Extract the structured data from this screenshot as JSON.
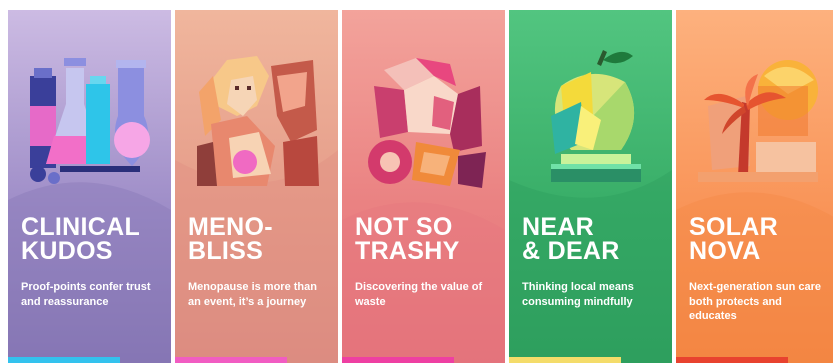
{
  "cards": [
    {
      "title": "CLINICAL\nKUDOS",
      "description": "Proof-points confer trust and reassurance",
      "accent_color": "#33c2ee",
      "background": [
        "#cbb9e2",
        "#9a88c4",
        "#8575b2"
      ],
      "icon": "lab-flasks-icon"
    },
    {
      "title": "MENO-\nBLISS",
      "description": "Menopause is more than an event, it’s a journey",
      "accent_color": "#f15cc2",
      "background": [
        "#f0b59c",
        "#e49a88",
        "#dc8d80"
      ],
      "icon": "woman-portrait-icon"
    },
    {
      "title": "NOT SO\nTRASHY",
      "description": "Discovering the value of waste",
      "accent_color": "#ee3fa2",
      "background": [
        "#f2a19a",
        "#ea7f80",
        "#e5727a"
      ],
      "icon": "crumpled-waste-icon"
    },
    {
      "title": "NEAR\n& DEAR",
      "description": "Thinking local means consuming mindfully",
      "accent_color": "#f4dc6a",
      "background": [
        "#4fc37f",
        "#37ad67",
        "#2fa05e"
      ],
      "icon": "apple-on-pedestal-icon"
    },
    {
      "title": "SOLAR\nNOVA",
      "description": "Next-generation sun care both protects and educates",
      "accent_color": "#e8422f",
      "background": [
        "#fdb07c",
        "#f9935a",
        "#f4843f"
      ],
      "icon": "sun-palm-icon"
    }
  ]
}
